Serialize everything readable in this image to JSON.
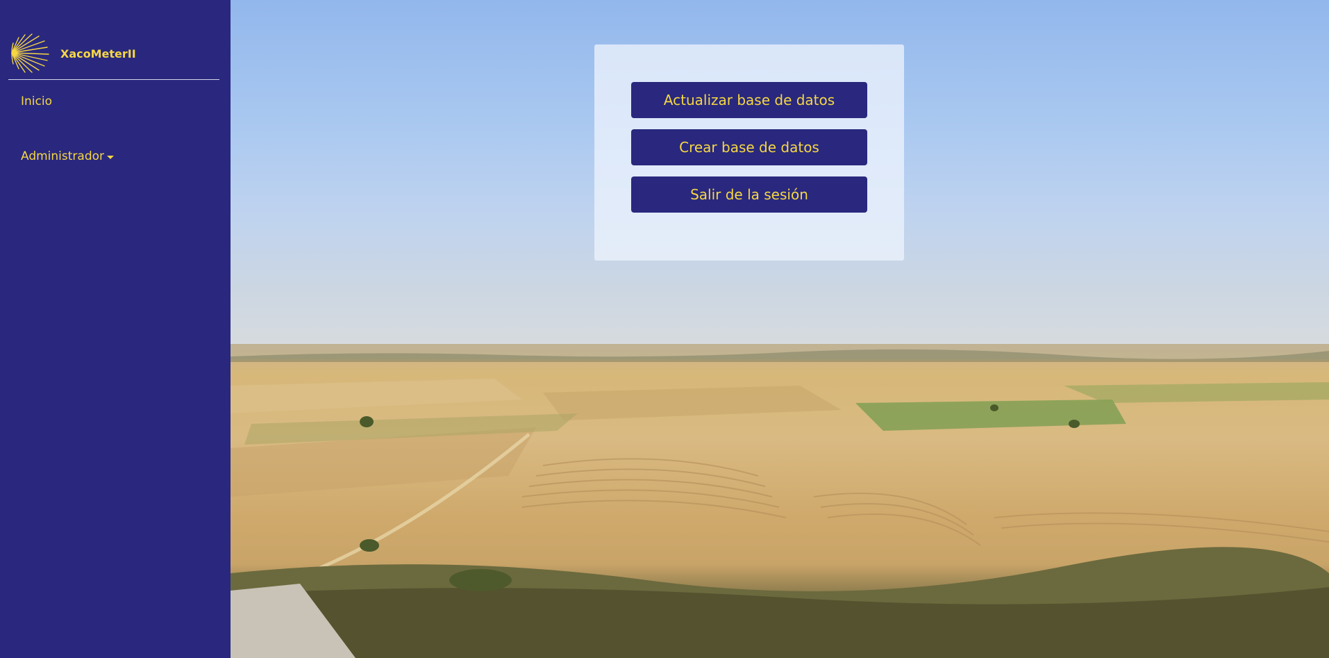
{
  "brand": {
    "name": "XacoMeterII",
    "logo_icon": "scallop-shell-icon"
  },
  "sidebar": {
    "items": [
      {
        "label": "Inicio"
      },
      {
        "label": "Administrador",
        "icon": "caret-down-icon"
      }
    ]
  },
  "card": {
    "buttons": [
      {
        "label": "Actualizar base de datos"
      },
      {
        "label": "Crear base de datos"
      },
      {
        "label": "Salir de la sesión"
      }
    ]
  },
  "colors": {
    "sidebar_bg": "#29287e",
    "accent": "#f6d743",
    "button_bg": "#29287e"
  }
}
